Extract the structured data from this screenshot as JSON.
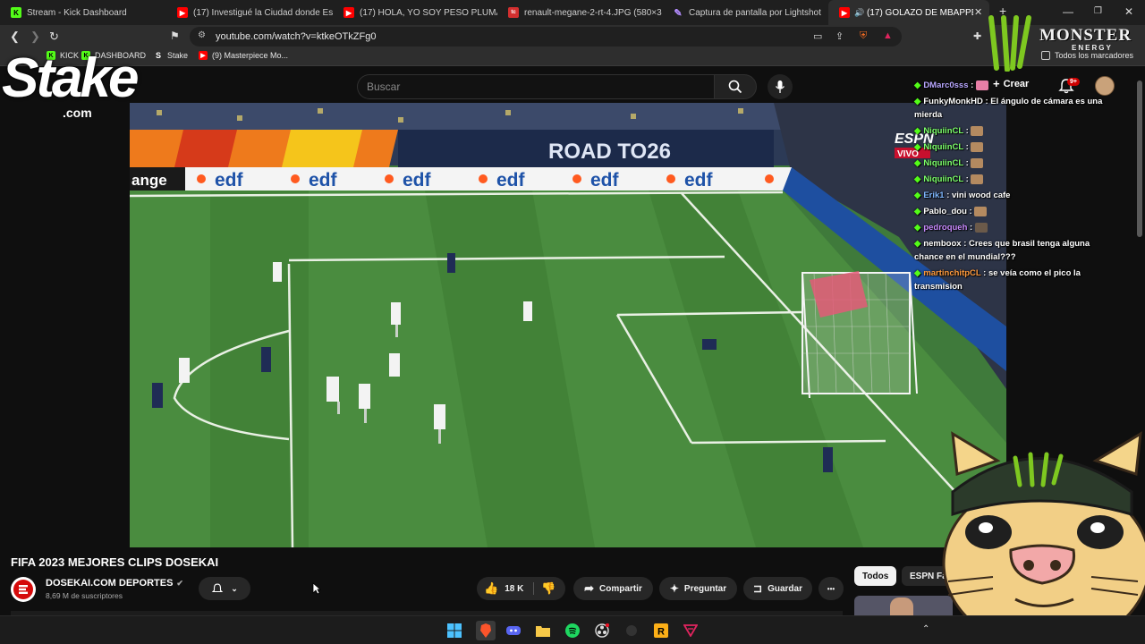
{
  "browser": {
    "tabs": [
      {
        "title": "Stream - Kick Dashboard",
        "icon": "kick-icon"
      },
      {
        "title": "(17) Investigué la Ciudad donde Esco",
        "icon": "youtube-icon"
      },
      {
        "title": "(17) HOLA, YO SOY PESO PLUMA // I",
        "icon": "youtube-icon"
      },
      {
        "title": "renault-megane-2-rt-4.JPG (580×31",
        "icon": "image-icon"
      },
      {
        "title": "Captura de pantalla por Lightshot",
        "icon": "lightshot-icon"
      },
      {
        "title": "(17) GOLAZO DE MBAPPÉ Y",
        "icon": "youtube-icon"
      }
    ],
    "new_tab_label": "+",
    "url": "youtube.com/watch?v=ktkeOTkZFg0",
    "bookmarks": [
      {
        "label": "KICK"
      },
      {
        "label": "DASHBOARD"
      },
      {
        "label": "Stake"
      },
      {
        "label": "(9) Masterpiece Mo..."
      }
    ],
    "all_bookmarks_label": "Todos los marcadores"
  },
  "youtube": {
    "search_placeholder": "Buscar",
    "create_label": "Crear",
    "notification_count": "9+",
    "video_title": "FIFA 2023 MEJORES CLIPS DOSEKAI",
    "channel_name": "DOSEKAI.COM DEPORTES",
    "channel_subs": "8,69 M de suscriptores",
    "like_count": "18 K",
    "share_label": "Compartir",
    "ask_label": "Preguntar",
    "save_label": "Guardar",
    "more_label": "•••",
    "chips": [
      {
        "label": "Todos"
      },
      {
        "label": "ESPN Fa"
      }
    ]
  },
  "video_overlay": {
    "ad_board_text": "edf",
    "ad_board_left": "ange",
    "road_banner": "ROAD TO26",
    "broadcaster": "ESPN",
    "live_label": "VIVO"
  },
  "chat": [
    {
      "user": "DMarc0sss",
      "user_color": "#b9a7ff",
      "text": ":"
    },
    {
      "user": "FunkyMonkHD",
      "user_color": "#ffffff",
      "text": ": El ángulo de cámara es una mierda"
    },
    {
      "user": "NiquiinCL",
      "user_color": "#7cff6b",
      "text": ":"
    },
    {
      "user": "NiquiinCL",
      "user_color": "#7cff6b",
      "text": ":"
    },
    {
      "user": "NiquiinCL",
      "user_color": "#7cff6b",
      "text": ":"
    },
    {
      "user": "NiquiinCL",
      "user_color": "#7cff6b",
      "text": ":"
    },
    {
      "user": "Erik1",
      "user_color": "#7fb8ff",
      "text": ": vini wood cafe"
    },
    {
      "user": "Pablo_dou",
      "user_color": "#ffffff",
      "text": ":"
    },
    {
      "user": "pedroqueh",
      "user_color": "#c98bff",
      "text": ":"
    },
    {
      "user": "nemboox",
      "user_color": "#ffffff",
      "text": ": Crees que brasil tenga alguna chance en el mundial???"
    },
    {
      "user": "martinchitpCL",
      "user_color": "#ff9a3c",
      "text": ": se veía como el pico la transmision"
    }
  ],
  "overlays": {
    "stake_logo": "Stake",
    "stake_sub": ".com",
    "monster_brand": "MONSTER",
    "monster_sub": "ENERGY"
  },
  "colors": {
    "youtube_red": "#ff0000",
    "kick_green": "#53fc18",
    "page_bg": "#0f0f0f"
  }
}
